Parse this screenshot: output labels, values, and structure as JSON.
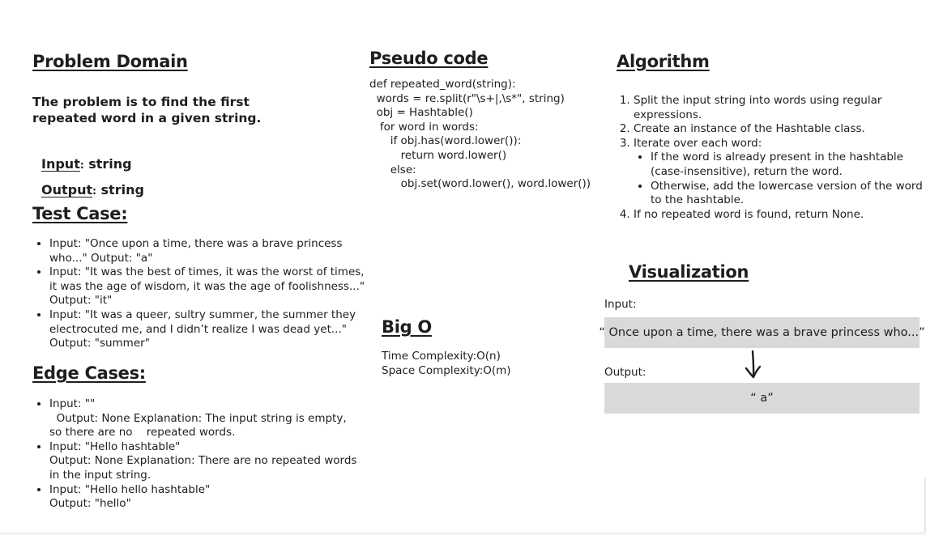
{
  "problem_domain": {
    "heading": "Problem Domain",
    "statement": "The problem is to find the first repeated word in a given string.",
    "input_label": "Input",
    "input_colon": ":",
    "input_value": " string",
    "output_label": "Output",
    "output_colon": ":",
    "output_value": " string"
  },
  "test_case": {
    "heading": "Test Case:",
    "items": [
      "Input: \"Once upon a time, there was a brave princess who...\" Output: \"a\"",
      "Input: \"It was the best of times, it was the worst of times, it was the age of wisdom, it was the age of foolishness...\" Output: \"it\"",
      "Input: \"It was a queer, sultry summer, the summer they electrocuted me, and I didn’t realize I was dead yet...\" Output: \"summer\""
    ]
  },
  "edge_cases": {
    "heading": "Edge Cases:",
    "items": [
      {
        "line1": "Input: \"\"",
        "line2": "  Output: None Explanation: The input string is empty, so there are no    repeated words."
      },
      {
        "line1": "Input: \"Hello hashtable\"",
        "line2": "Output: None Explanation: There are no repeated words in the input string."
      },
      {
        "line1": "Input: \"Hello hello hashtable\"",
        "line2": "Output: \"hello\""
      }
    ]
  },
  "pseudo_code": {
    "heading": "Pseudo code",
    "lines": [
      "def repeated_word(string):",
      "",
      "  words = re.split(r\"\\s+|,\\s*\", string)",
      "  obj = Hashtable()",
      "   for word in words:",
      "      if obj.has(word.lower()):",
      "         return word.lower()",
      "      else:",
      "         obj.set(word.lower(), word.lower())"
    ]
  },
  "big_o": {
    "heading": "Big O",
    "time": "Time Complexity:O(n)",
    "space": "Space Complexity:O(m)"
  },
  "algorithm": {
    "heading": "Algorithm ",
    "steps": [
      "Split the input string into words using regular expressions.",
      "Create an instance of the Hashtable class.",
      "Iterate over each word:",
      "If no repeated word is found, return None."
    ],
    "substeps": [
      "If the word is already present in the hashtable (case-insensitive), return the word.",
      "Otherwise, add the lowercase version of the word to the hashtable."
    ]
  },
  "visualization": {
    "heading": "Visualization",
    "input_label": "Input:",
    "input_value": "“ Once upon a time, there was a brave princess who...”",
    "output_label": "Output:",
    "output_value": "“ a”",
    "arrow_icon": "hand-drawn-down-arrow-icon",
    "box_color": "#d9d9d9"
  }
}
